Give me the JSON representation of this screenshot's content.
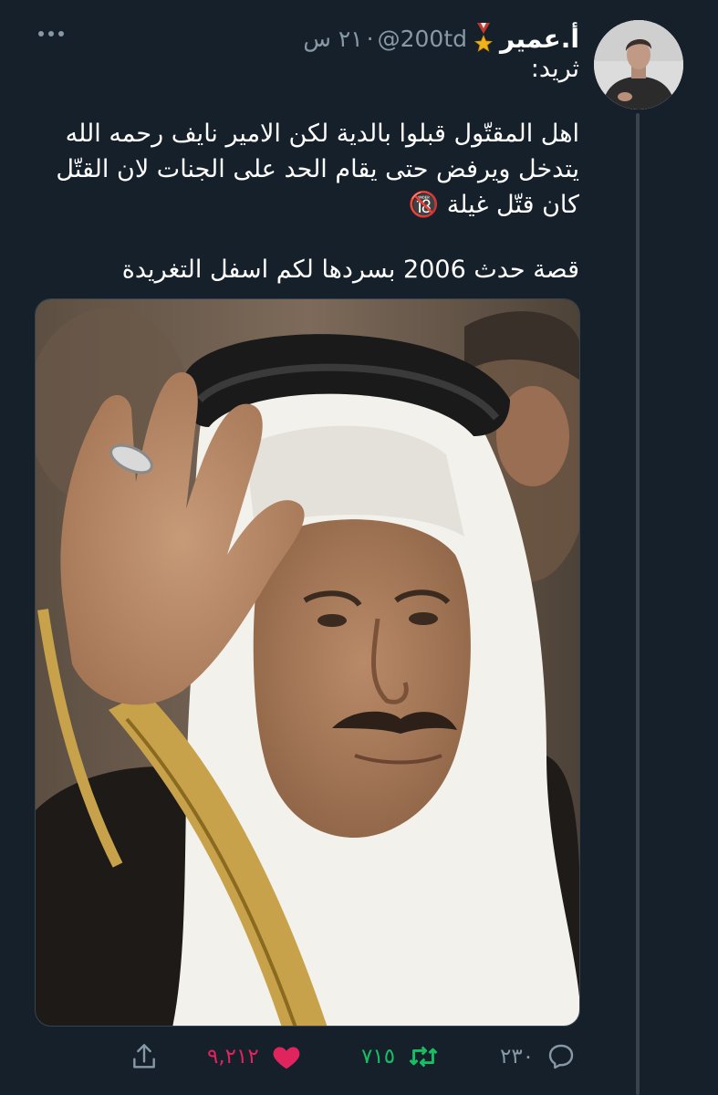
{
  "tweet": {
    "author_name": "أ.عمير",
    "badge_icon": "military-medal-icon",
    "handle": "@200td",
    "separator": "·",
    "time": "٢١ س",
    "label": "ثريد:",
    "lines": [
      "اهل المقتّول قبلوا بالدية لكن الامير نايف رحمه الله",
      "يتدخل ويرفض حتى يقام الحد على الجنات لان القتّل",
      "كان قتّل غيلة 🔞",
      "قصة حدث 2006 بسردها لكم اسفل التغريدة"
    ]
  },
  "actions": {
    "reply_count": "٢٣٠",
    "retweet_count": "٧١٥",
    "like_count": "٩,٢١٢"
  },
  "colors": {
    "background": "#15202b",
    "secondary_text": "#8899a6",
    "retweet_green": "#17bf63",
    "like_pink": "#e0245e",
    "thread_line": "#38444d"
  }
}
